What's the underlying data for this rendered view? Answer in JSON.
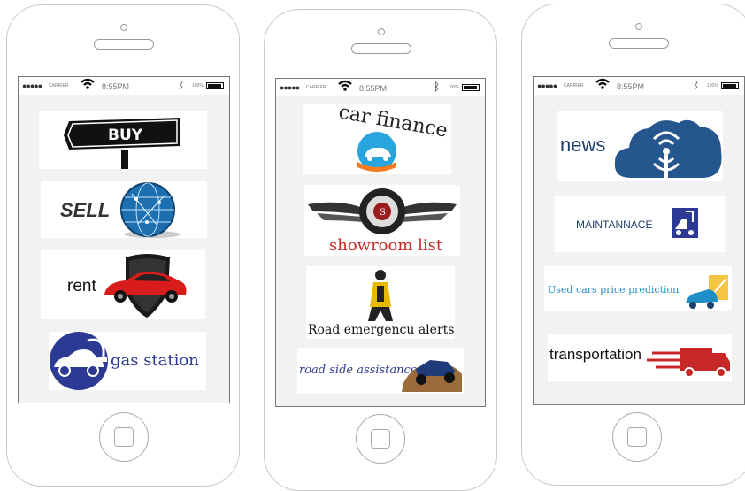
{
  "phones": [
    {
      "status": {
        "carrier": "CARRIER",
        "time": "8:55PM",
        "battery": "100%"
      },
      "tiles": [
        {
          "label": "BUY",
          "icon": "street-sign-icon"
        },
        {
          "label": "SELL",
          "icon": "globe-icon"
        },
        {
          "label": "rent",
          "icon": "red-car-shield-icon"
        },
        {
          "label": "gas station",
          "icon": "gas-pump-car-icon"
        }
      ]
    },
    {
      "status": {
        "carrier": "CARRIER",
        "time": "8:55PM",
        "battery": "100%"
      },
      "tiles": [
        {
          "label": "car finance",
          "icon": "car-in-hand-icon"
        },
        {
          "label": "showroom list",
          "icon": "winged-wheel-icon"
        },
        {
          "label": "Road emergencu alerts",
          "icon": "roadworker-icon"
        },
        {
          "label": "road side assistance",
          "icon": "offroad-car-icon"
        }
      ]
    },
    {
      "status": {
        "carrier": "CARRIER",
        "time": "8:55PM",
        "battery": "100%"
      },
      "tiles": [
        {
          "label": "news",
          "icon": "cloud-broadcast-icon"
        },
        {
          "label": "MAINTANNACE",
          "icon": "tow-truck-icon"
        },
        {
          "label": "Used cars price prediction",
          "icon": "car-chart-icon"
        },
        {
          "label": "transportation",
          "icon": "speeding-truck-icon"
        }
      ]
    }
  ],
  "colors": {
    "navy": "#2c3a93",
    "red": "#c62828",
    "teal": "#1f8dc6",
    "dark": "#222222"
  }
}
